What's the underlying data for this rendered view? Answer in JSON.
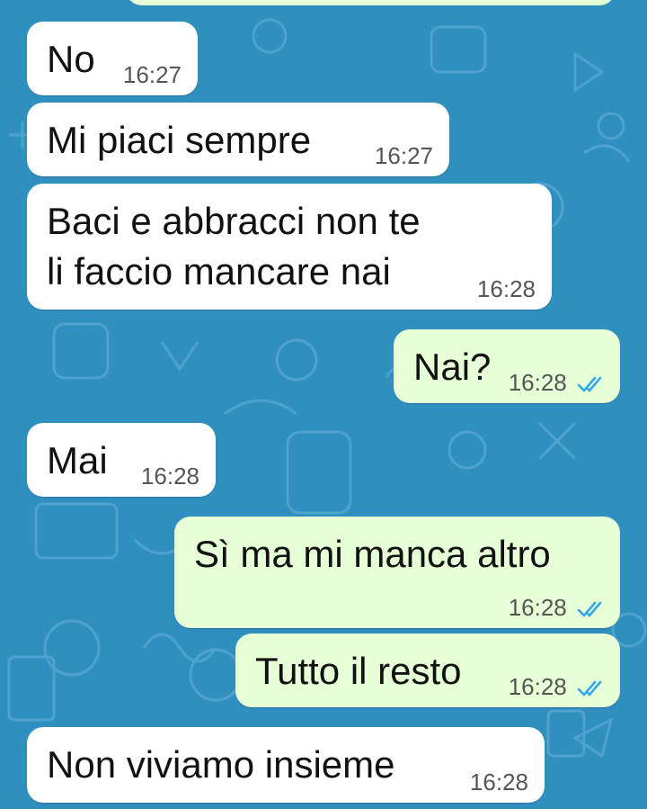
{
  "colors": {
    "background": "#2f8fbf",
    "incoming_bubble": "#ffffff",
    "outgoing_bubble": "#e6ffd6",
    "read_tick": "#34a7e6"
  },
  "messages": [
    {
      "text": "No",
      "time": "16:27",
      "direction": "incoming"
    },
    {
      "text": "Mi piaci sempre",
      "time": "16:27",
      "direction": "incoming"
    },
    {
      "text": "Baci e abbracci non te li faccio mancare nai",
      "time": "16:28",
      "direction": "incoming"
    },
    {
      "text": "Nai?",
      "time": "16:28",
      "direction": "outgoing",
      "status_icon": "double-check-read-icon"
    },
    {
      "text": "Mai",
      "time": "16:28",
      "direction": "incoming"
    },
    {
      "text": "Sì ma mi manca altro",
      "time": "16:28",
      "direction": "outgoing",
      "status_icon": "double-check-read-icon"
    },
    {
      "text": "Tutto il resto",
      "time": "16:28",
      "direction": "outgoing",
      "status_icon": "double-check-read-icon"
    },
    {
      "text": "Non viviamo insieme",
      "time": "16:28",
      "direction": "incoming"
    }
  ]
}
